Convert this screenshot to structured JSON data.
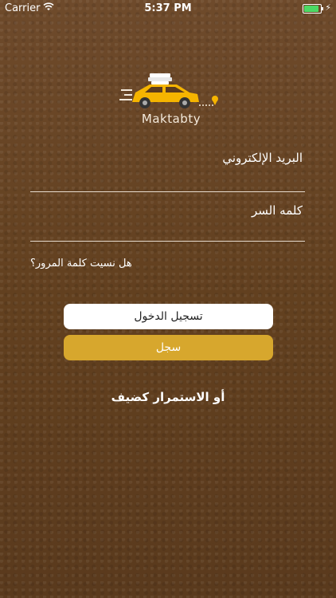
{
  "status_bar": {
    "carrier": "Carrier",
    "time": "5:37 PM",
    "battery_level": 0.9,
    "battery_color": "#4cd964"
  },
  "logo": {
    "text": "Maktabty",
    "car_color": "#f5b400"
  },
  "form": {
    "email_label": "البريد الإلكتروني",
    "password_label": "كلمه السر",
    "forgot_password": "هل نسيت كلمة المرور؟"
  },
  "buttons": {
    "login": "تسجيل الدخول",
    "register": "سجل",
    "register_color": "#d7a72d"
  },
  "guest_link": "أو الاستمرار كضيف"
}
